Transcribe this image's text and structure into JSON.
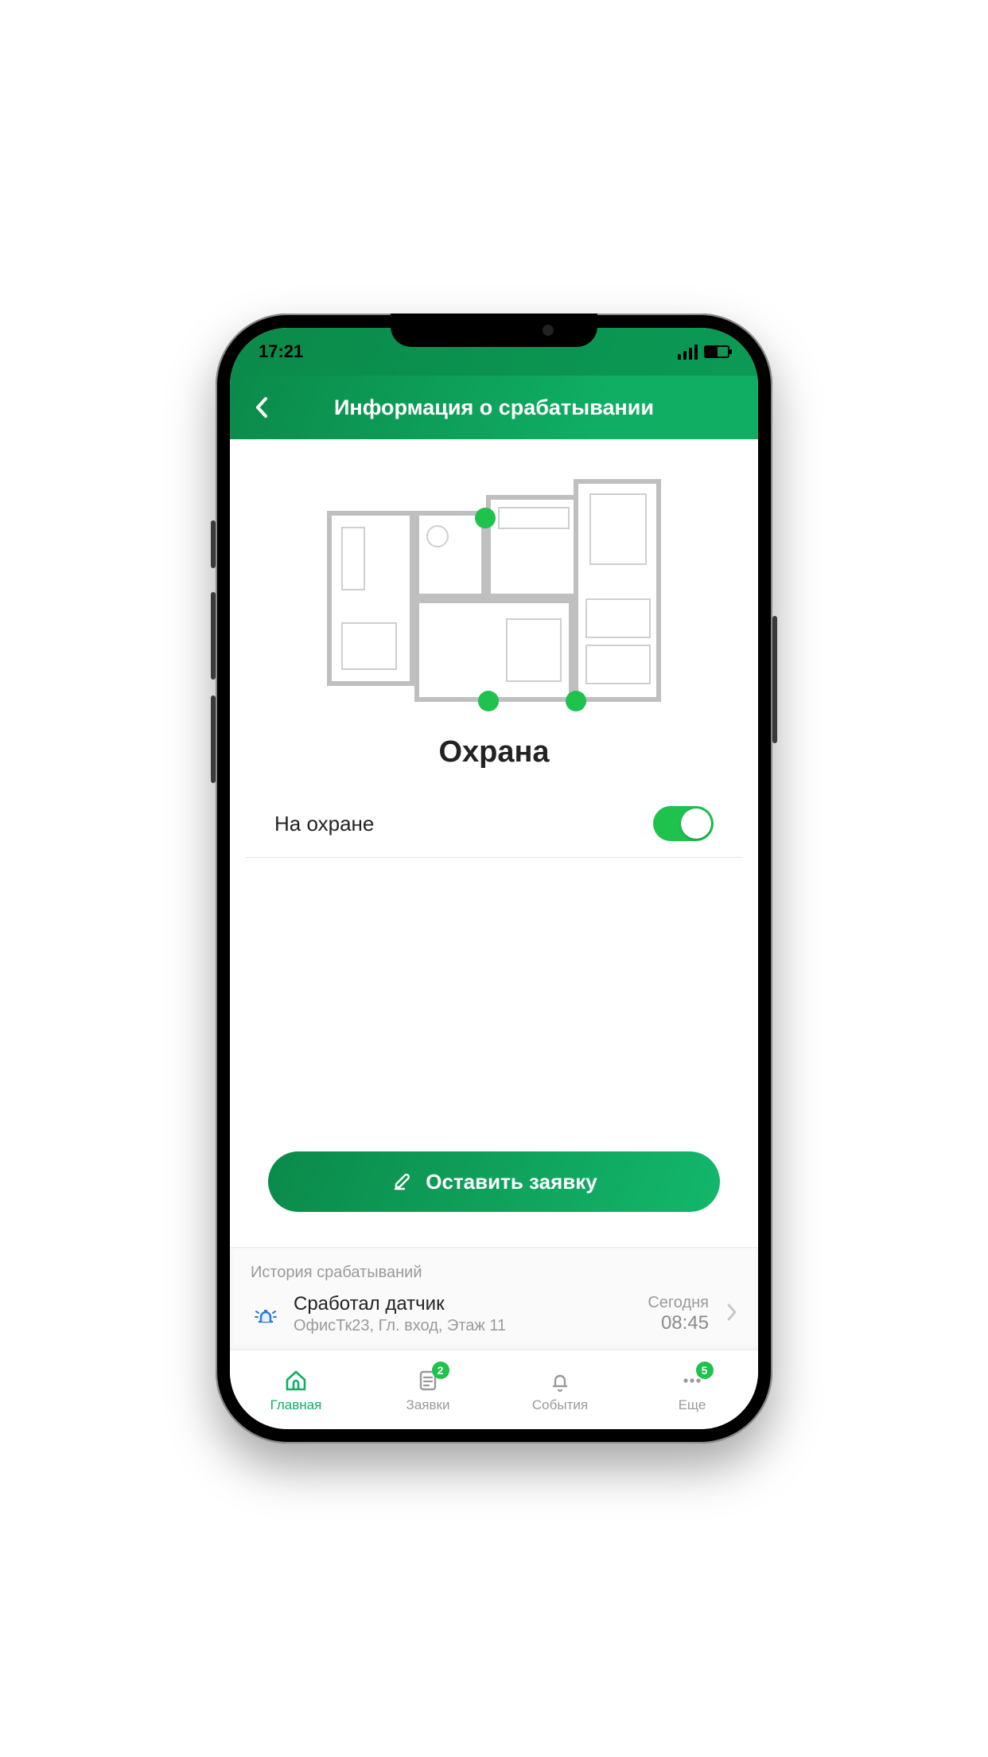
{
  "status": {
    "time": "17:21"
  },
  "header": {
    "title": "Информация о срабатывании"
  },
  "section_title": "Охрана",
  "switch": {
    "label": "На охране",
    "on": true
  },
  "cta": {
    "label": "Оставить заявку"
  },
  "history": {
    "title": "История срабатываний",
    "items": [
      {
        "title": "Сработал датчик",
        "subtitle": "ОфисТк23, Гл. вход, Этаж 11",
        "when_day": "Сегодня",
        "when_time": "08:45"
      }
    ]
  },
  "tabs": [
    {
      "label": "Главная",
      "badge": null,
      "active": true
    },
    {
      "label": "Заявки",
      "badge": "2",
      "active": false
    },
    {
      "label": "События",
      "badge": null,
      "active": false
    },
    {
      "label": "Еще",
      "badge": "5",
      "active": false
    }
  ],
  "colors": {
    "accent": "#1ec24d",
    "brand_dark": "#0b8a4a",
    "brand_light": "#13b76c"
  }
}
